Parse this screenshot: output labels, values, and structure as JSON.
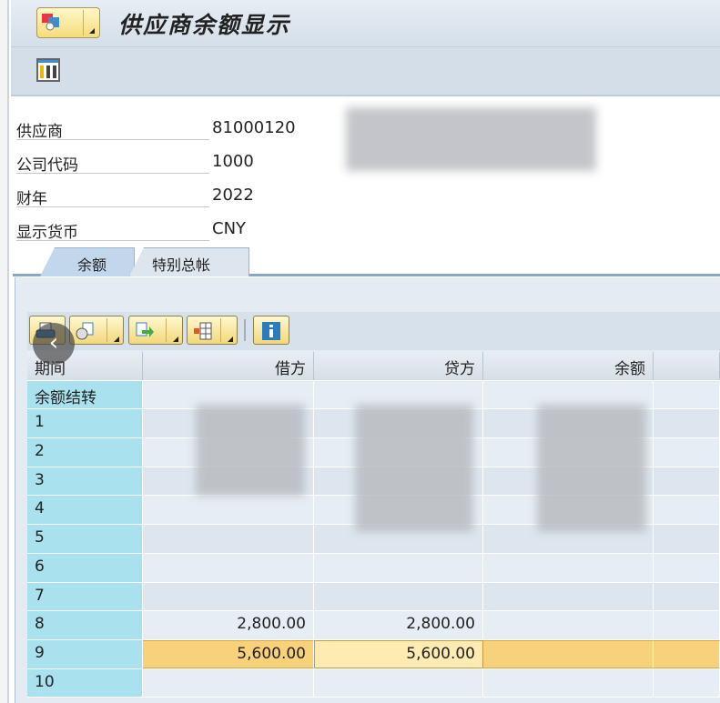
{
  "window": {
    "title": "供应商余额显示"
  },
  "fields": [
    {
      "label": "供应商",
      "value": "81000120"
    },
    {
      "label": "公司代码",
      "value": "1000"
    },
    {
      "label": "财年",
      "value": "2022"
    },
    {
      "label": "显示货币",
      "value": "CNY"
    }
  ],
  "tabs": [
    {
      "label": "余额"
    },
    {
      "label": "特别总帐"
    }
  ],
  "table": {
    "headers": [
      "期间",
      "借方",
      "贷方",
      "余额"
    ],
    "rows": [
      {
        "period": "余额结转",
        "debit": "",
        "credit": "",
        "balance": ""
      },
      {
        "period": "1",
        "debit": "",
        "credit": "",
        "balance": ""
      },
      {
        "period": "2",
        "debit": "",
        "credit": "",
        "balance": ""
      },
      {
        "period": "3",
        "debit": "",
        "credit": "",
        "balance": ""
      },
      {
        "period": "4",
        "debit": "",
        "credit": "",
        "balance": ""
      },
      {
        "period": "5",
        "debit": "",
        "credit": "",
        "balance": ""
      },
      {
        "period": "6",
        "debit": "",
        "credit": "",
        "balance": ""
      },
      {
        "period": "7",
        "debit": "",
        "credit": "",
        "balance": ""
      },
      {
        "period": "8",
        "debit": "2,800.00",
        "credit": "2,800.00",
        "balance": ""
      },
      {
        "period": "9",
        "debit": "5,600.00",
        "credit": "5,600.00",
        "balance": ""
      },
      {
        "period": "10",
        "debit": "",
        "credit": "",
        "balance": ""
      }
    ],
    "selected_row": "9"
  },
  "colors": {
    "selected_row": "#f8d27a",
    "period_column": "#a9e1ef"
  }
}
